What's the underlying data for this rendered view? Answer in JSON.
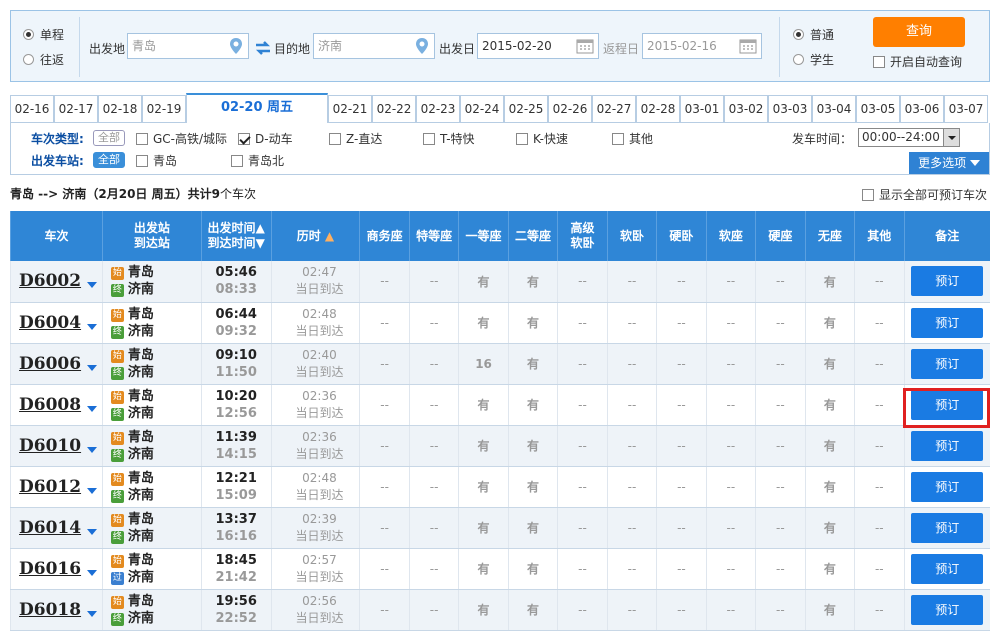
{
  "search": {
    "trip_single": "单程",
    "trip_round": "往返",
    "from_label": "出发地",
    "from_value": "青岛",
    "to_label": "目的地",
    "to_value": "济南",
    "depart_label": "出发日",
    "depart_value": "2015-02-20",
    "return_label": "返程日",
    "return_value": "2015-02-16",
    "ticket_normal": "普通",
    "ticket_student": "学生",
    "query_button": "查询",
    "auto_query": "开启自动查询"
  },
  "date_tabs": [
    "02-16",
    "02-17",
    "02-18",
    "02-19",
    "02-20 周五",
    "02-21",
    "02-22",
    "02-23",
    "02-24",
    "02-25",
    "02-26",
    "02-27",
    "02-28",
    "03-01",
    "03-02",
    "03-03",
    "03-04",
    "03-05",
    "03-06",
    "03-07"
  ],
  "active_tab": "02-20 周五",
  "filters": {
    "type_label": "车次类型:",
    "station_label": "出发车站:",
    "all": "全部",
    "types": [
      "GC-高铁/城际",
      "D-动车",
      "Z-直达",
      "T-特快",
      "K-快速",
      "其他"
    ],
    "stations": [
      "青岛",
      "青岛北"
    ],
    "time_label": "发车时间：",
    "time_value": "00:00--24:00",
    "more_options": "更多选项"
  },
  "summary": {
    "route": "青岛 --> 济南（2月20日  周五）共计",
    "count": "9",
    "suffix": "个车次",
    "show_all": "显示全部可预订车次"
  },
  "table": {
    "headers": {
      "train": "车次",
      "station1": "出发站",
      "station2": "到达站",
      "time1": "出发时间",
      "time2": "到达时间",
      "duration": "历时",
      "business": "商务座",
      "special": "特等座",
      "first": "一等座",
      "second": "二等座",
      "senior1": "高级",
      "senior2": "软卧",
      "soft_sleeper": "软卧",
      "hard_sleeper": "硬卧",
      "soft_seat": "软座",
      "hard_seat": "硬座",
      "no_seat": "无座",
      "other": "其他",
      "remark": "备注"
    },
    "rows": [
      {
        "code": "D6002",
        "from_badge": "始",
        "from": "青岛",
        "to_badge": "终",
        "to": "济南",
        "depart": "05:46",
        "arrive": "08:33",
        "duration": "02:47",
        "arrive_note": "当日到达",
        "first": "有",
        "second": "有",
        "no_seat": "有",
        "button": "预订"
      },
      {
        "code": "D6004",
        "from_badge": "始",
        "from": "青岛",
        "to_badge": "终",
        "to": "济南",
        "depart": "06:44",
        "arrive": "09:32",
        "duration": "02:48",
        "arrive_note": "当日到达",
        "first": "有",
        "second": "有",
        "no_seat": "有",
        "button": "预订"
      },
      {
        "code": "D6006",
        "from_badge": "始",
        "from": "青岛",
        "to_badge": "终",
        "to": "济南",
        "depart": "09:10",
        "arrive": "11:50",
        "duration": "02:40",
        "arrive_note": "当日到达",
        "first": "16",
        "second": "有",
        "no_seat": "有",
        "button": "预订"
      },
      {
        "code": "D6008",
        "from_badge": "始",
        "from": "青岛",
        "to_badge": "终",
        "to": "济南",
        "depart": "10:20",
        "arrive": "12:56",
        "duration": "02:36",
        "arrive_note": "当日到达",
        "first": "有",
        "second": "有",
        "no_seat": "有",
        "button": "预订"
      },
      {
        "code": "D6010",
        "from_badge": "始",
        "from": "青岛",
        "to_badge": "终",
        "to": "济南",
        "depart": "11:39",
        "arrive": "14:15",
        "duration": "02:36",
        "arrive_note": "当日到达",
        "first": "有",
        "second": "有",
        "no_seat": "有",
        "button": "预订"
      },
      {
        "code": "D6012",
        "from_badge": "始",
        "from": "青岛",
        "to_badge": "终",
        "to": "济南",
        "depart": "12:21",
        "arrive": "15:09",
        "duration": "02:48",
        "arrive_note": "当日到达",
        "first": "有",
        "second": "有",
        "no_seat": "有",
        "button": "预订"
      },
      {
        "code": "D6014",
        "from_badge": "始",
        "from": "青岛",
        "to_badge": "终",
        "to": "济南",
        "depart": "13:37",
        "arrive": "16:16",
        "duration": "02:39",
        "arrive_note": "当日到达",
        "first": "有",
        "second": "有",
        "no_seat": "有",
        "button": "预订"
      },
      {
        "code": "D6016",
        "from_badge": "始",
        "from": "青岛",
        "to_badge": "过",
        "to": "济南",
        "depart": "18:45",
        "arrive": "21:42",
        "duration": "02:57",
        "arrive_note": "当日到达",
        "first": "有",
        "second": "有",
        "no_seat": "有",
        "button": "预订"
      },
      {
        "code": "D6018",
        "from_badge": "始",
        "from": "青岛",
        "to_badge": "终",
        "to": "济南",
        "depart": "19:56",
        "arrive": "22:52",
        "duration": "02:56",
        "arrive_note": "当日到达",
        "first": "有",
        "second": "有",
        "no_seat": "有",
        "button": "预订"
      }
    ],
    "empty": "--"
  },
  "colors": {
    "accent": "#2f86d6",
    "query": "#ff7f00",
    "highlight": "#e02020",
    "available": "#2a9a2a"
  }
}
